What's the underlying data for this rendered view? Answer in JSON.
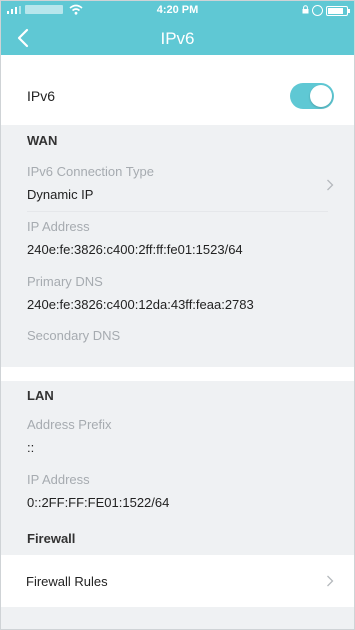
{
  "status_bar": {
    "time": "4:20 PM"
  },
  "header": {
    "title": "IPv6"
  },
  "ipv6_toggle": {
    "label": "IPv6",
    "enabled": true,
    "accent": "#5fc8d4"
  },
  "wan": {
    "heading": "WAN",
    "connection_type": {
      "label": "IPv6 Connection Type",
      "value": "Dynamic IP"
    },
    "ip_address": {
      "label": "IP Address",
      "value": "240e:fe:3826:c400:2ff:ff:fe01:1523/64"
    },
    "primary_dns": {
      "label": "Primary DNS",
      "value": "240e:fe:3826:c400:12da:43ff:feaa:2783"
    },
    "secondary_dns": {
      "label": "Secondary DNS",
      "value": ""
    }
  },
  "lan": {
    "heading": "LAN",
    "address_prefix": {
      "label": "Address Prefix",
      "value": "::"
    },
    "ip_address": {
      "label": "IP Address",
      "value": "0::2FF:FF:FE01:1522/64"
    }
  },
  "firewall": {
    "heading": "Firewall",
    "rules_label": "Firewall Rules"
  },
  "icons": {
    "back": "chevron-left-icon",
    "row_arrow": "chevron-right-icon",
    "wifi": "wifi-icon",
    "battery": "battery-icon"
  }
}
